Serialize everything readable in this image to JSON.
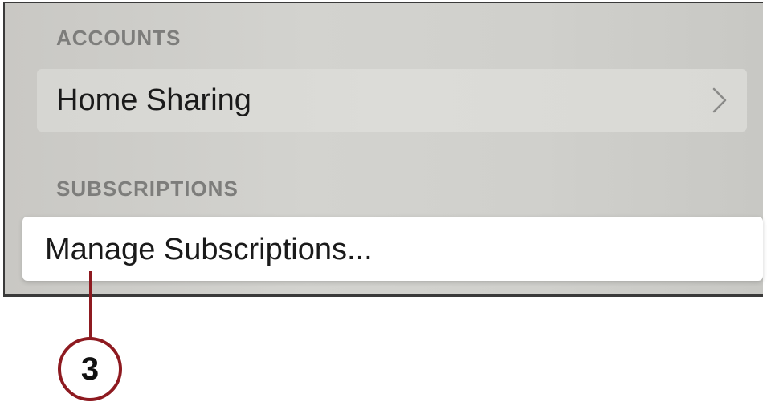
{
  "settings": {
    "accounts_header": "ACCOUNTS",
    "home_sharing_label": "Home Sharing",
    "subscriptions_header": "SUBSCRIPTIONS",
    "manage_subscriptions_label": "Manage Subscriptions..."
  },
  "callout": {
    "number": "3",
    "color": "#8e1a20"
  },
  "icons": {
    "row_chevron": "chevron-right-icon"
  },
  "colors": {
    "background": "#d2d2ce",
    "header_text": "#7d7d7b",
    "focused_row": "#ffffff"
  }
}
